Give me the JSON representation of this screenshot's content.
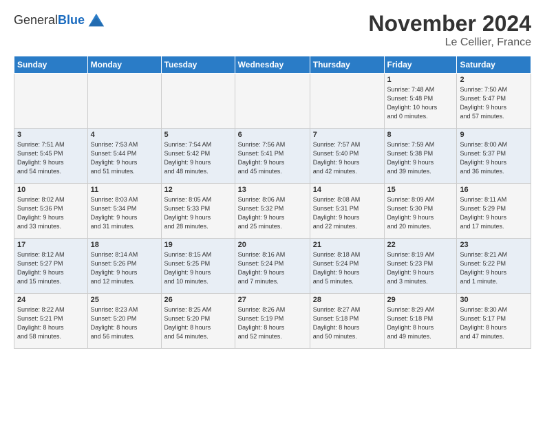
{
  "logo": {
    "line1": "General",
    "line2": "Blue"
  },
  "title": "November 2024",
  "subtitle": "Le Cellier, France",
  "weekdays": [
    "Sunday",
    "Monday",
    "Tuesday",
    "Wednesday",
    "Thursday",
    "Friday",
    "Saturday"
  ],
  "weeks": [
    [
      {
        "day": "",
        "info": ""
      },
      {
        "day": "",
        "info": ""
      },
      {
        "day": "",
        "info": ""
      },
      {
        "day": "",
        "info": ""
      },
      {
        "day": "",
        "info": ""
      },
      {
        "day": "1",
        "info": "Sunrise: 7:48 AM\nSunset: 5:48 PM\nDaylight: 10 hours\nand 0 minutes."
      },
      {
        "day": "2",
        "info": "Sunrise: 7:50 AM\nSunset: 5:47 PM\nDaylight: 9 hours\nand 57 minutes."
      }
    ],
    [
      {
        "day": "3",
        "info": "Sunrise: 7:51 AM\nSunset: 5:45 PM\nDaylight: 9 hours\nand 54 minutes."
      },
      {
        "day": "4",
        "info": "Sunrise: 7:53 AM\nSunset: 5:44 PM\nDaylight: 9 hours\nand 51 minutes."
      },
      {
        "day": "5",
        "info": "Sunrise: 7:54 AM\nSunset: 5:42 PM\nDaylight: 9 hours\nand 48 minutes."
      },
      {
        "day": "6",
        "info": "Sunrise: 7:56 AM\nSunset: 5:41 PM\nDaylight: 9 hours\nand 45 minutes."
      },
      {
        "day": "7",
        "info": "Sunrise: 7:57 AM\nSunset: 5:40 PM\nDaylight: 9 hours\nand 42 minutes."
      },
      {
        "day": "8",
        "info": "Sunrise: 7:59 AM\nSunset: 5:38 PM\nDaylight: 9 hours\nand 39 minutes."
      },
      {
        "day": "9",
        "info": "Sunrise: 8:00 AM\nSunset: 5:37 PM\nDaylight: 9 hours\nand 36 minutes."
      }
    ],
    [
      {
        "day": "10",
        "info": "Sunrise: 8:02 AM\nSunset: 5:36 PM\nDaylight: 9 hours\nand 33 minutes."
      },
      {
        "day": "11",
        "info": "Sunrise: 8:03 AM\nSunset: 5:34 PM\nDaylight: 9 hours\nand 31 minutes."
      },
      {
        "day": "12",
        "info": "Sunrise: 8:05 AM\nSunset: 5:33 PM\nDaylight: 9 hours\nand 28 minutes."
      },
      {
        "day": "13",
        "info": "Sunrise: 8:06 AM\nSunset: 5:32 PM\nDaylight: 9 hours\nand 25 minutes."
      },
      {
        "day": "14",
        "info": "Sunrise: 8:08 AM\nSunset: 5:31 PM\nDaylight: 9 hours\nand 22 minutes."
      },
      {
        "day": "15",
        "info": "Sunrise: 8:09 AM\nSunset: 5:30 PM\nDaylight: 9 hours\nand 20 minutes."
      },
      {
        "day": "16",
        "info": "Sunrise: 8:11 AM\nSunset: 5:29 PM\nDaylight: 9 hours\nand 17 minutes."
      }
    ],
    [
      {
        "day": "17",
        "info": "Sunrise: 8:12 AM\nSunset: 5:27 PM\nDaylight: 9 hours\nand 15 minutes."
      },
      {
        "day": "18",
        "info": "Sunrise: 8:14 AM\nSunset: 5:26 PM\nDaylight: 9 hours\nand 12 minutes."
      },
      {
        "day": "19",
        "info": "Sunrise: 8:15 AM\nSunset: 5:25 PM\nDaylight: 9 hours\nand 10 minutes."
      },
      {
        "day": "20",
        "info": "Sunrise: 8:16 AM\nSunset: 5:24 PM\nDaylight: 9 hours\nand 7 minutes."
      },
      {
        "day": "21",
        "info": "Sunrise: 8:18 AM\nSunset: 5:24 PM\nDaylight: 9 hours\nand 5 minutes."
      },
      {
        "day": "22",
        "info": "Sunrise: 8:19 AM\nSunset: 5:23 PM\nDaylight: 9 hours\nand 3 minutes."
      },
      {
        "day": "23",
        "info": "Sunrise: 8:21 AM\nSunset: 5:22 PM\nDaylight: 9 hours\nand 1 minute."
      }
    ],
    [
      {
        "day": "24",
        "info": "Sunrise: 8:22 AM\nSunset: 5:21 PM\nDaylight: 8 hours\nand 58 minutes."
      },
      {
        "day": "25",
        "info": "Sunrise: 8:23 AM\nSunset: 5:20 PM\nDaylight: 8 hours\nand 56 minutes."
      },
      {
        "day": "26",
        "info": "Sunrise: 8:25 AM\nSunset: 5:20 PM\nDaylight: 8 hours\nand 54 minutes."
      },
      {
        "day": "27",
        "info": "Sunrise: 8:26 AM\nSunset: 5:19 PM\nDaylight: 8 hours\nand 52 minutes."
      },
      {
        "day": "28",
        "info": "Sunrise: 8:27 AM\nSunset: 5:18 PM\nDaylight: 8 hours\nand 50 minutes."
      },
      {
        "day": "29",
        "info": "Sunrise: 8:29 AM\nSunset: 5:18 PM\nDaylight: 8 hours\nand 49 minutes."
      },
      {
        "day": "30",
        "info": "Sunrise: 8:30 AM\nSunset: 5:17 PM\nDaylight: 8 hours\nand 47 minutes."
      }
    ]
  ]
}
